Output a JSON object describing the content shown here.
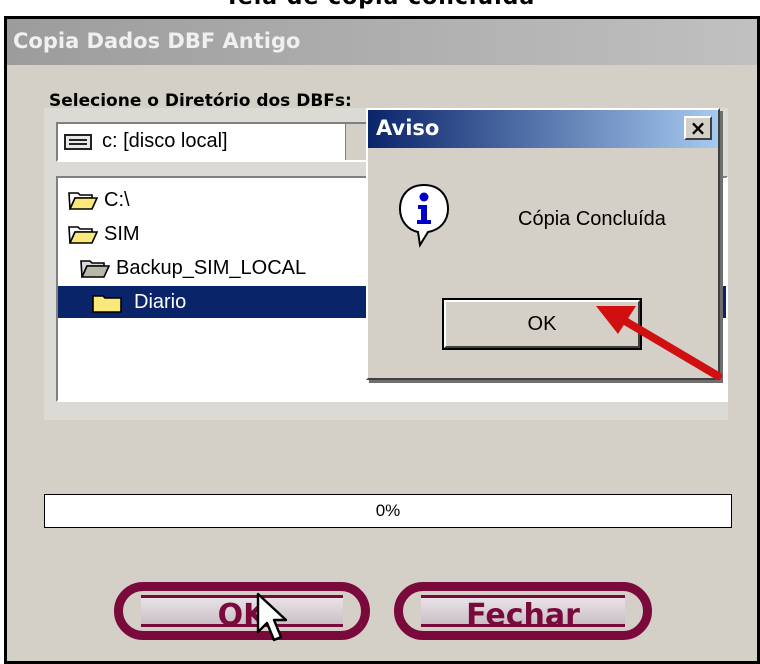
{
  "caption": "Tela de cópia concluída",
  "window": {
    "title": "Copia Dados DBF Antigo"
  },
  "directory_label": "Selecione o Diretório dos DBFs:",
  "drive": {
    "icon": "drive-icon",
    "value": "c: [disco local]"
  },
  "tree": {
    "items": [
      {
        "label": "C:\\",
        "icon": "open-folder-icon",
        "selected": false
      },
      {
        "label": "SIM",
        "icon": "open-folder-icon",
        "selected": false
      },
      {
        "label": "Backup_SIM_LOCAL",
        "icon": "open-folder-icon",
        "selected": false
      },
      {
        "label": "Diario",
        "icon": "folder-icon",
        "selected": true
      }
    ]
  },
  "progress": {
    "value": 0,
    "label": "0%"
  },
  "buttons": {
    "ok_label": "OK",
    "close_label": "Fechar"
  },
  "dialog": {
    "title": "Aviso",
    "close_glyph": "×",
    "icon": "info-icon",
    "message": "Cópia Concluída",
    "ok_label": "OK"
  },
  "colors": {
    "titlebar_active": "#0a246a",
    "selection": "#0a246a",
    "pill_border": "#7a0a3c",
    "annotation_arrow": "#d01010"
  }
}
